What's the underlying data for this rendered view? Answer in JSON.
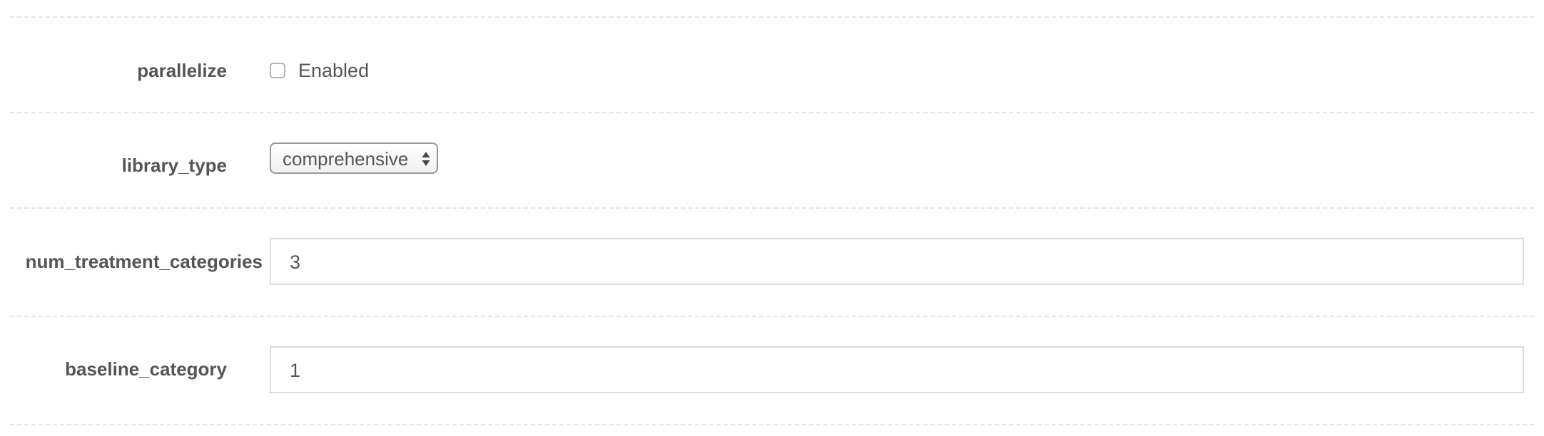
{
  "fields": {
    "parallelize": {
      "label": "parallelize",
      "checkbox_label": "Enabled",
      "checked": false
    },
    "library_type": {
      "label": "library_type",
      "selected": "comprehensive"
    },
    "num_treatment_categories": {
      "label": "num_treatment_categories",
      "value": "3"
    },
    "baseline_category": {
      "label": "baseline_category",
      "value": "1"
    }
  },
  "icons": {
    "select_arrows": "up-down-arrows-icon"
  }
}
